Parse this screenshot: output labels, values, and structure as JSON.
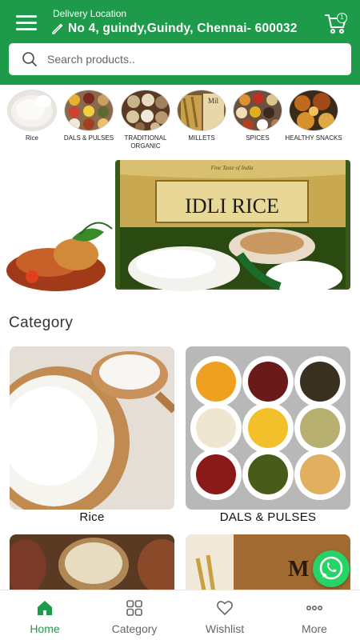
{
  "header": {
    "delivery_label": "Delivery Location",
    "address": "No 4, guindy,Guindy,  Chennai- 600032",
    "cart_count": "1",
    "brand_color": "#1e9a4b"
  },
  "search": {
    "placeholder": "Search products.."
  },
  "categories_strip": [
    {
      "label": "Rice"
    },
    {
      "label": "DALS & PULSES"
    },
    {
      "label": "TRADITIONAL ORGANIC"
    },
    {
      "label": "MILLETS"
    },
    {
      "label": "SPICES"
    },
    {
      "label": "HEALTHY SNACKS"
    }
  ],
  "banner": {
    "tagline": "Fine Taste of India",
    "title": "IDLI RICE"
  },
  "category_section": {
    "title": "Category",
    "cards": [
      {
        "label": "Rice"
      },
      {
        "label": "DALS & PULSES"
      },
      {
        "label": ""
      },
      {
        "label": ""
      }
    ],
    "partial_card_text": "M"
  },
  "bottom_nav": [
    {
      "label": "Home",
      "icon": "home-icon",
      "active": true
    },
    {
      "label": "Category",
      "icon": "grid-icon",
      "active": false
    },
    {
      "label": "Wishlist",
      "icon": "heart-icon",
      "active": false
    },
    {
      "label": "More",
      "icon": "more-dots-icon",
      "active": false
    }
  ]
}
